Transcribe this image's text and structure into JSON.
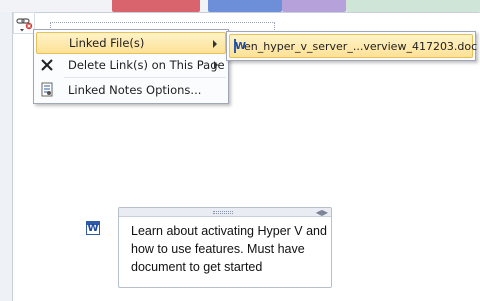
{
  "context_menu": {
    "items": [
      {
        "label": "Linked File(s)",
        "icon": "linked-file-icon",
        "has_submenu": true,
        "highlighted": true
      },
      {
        "label": "Delete Link(s) on This Page",
        "icon": "delete-x-icon",
        "has_submenu": true,
        "highlighted": false
      },
      {
        "label": "Linked Notes Options...",
        "icon": "options-document-icon",
        "has_submenu": false,
        "highlighted": false
      }
    ]
  },
  "submenu": {
    "file_name": "en_hyper_v_server_...verview_417203.doc",
    "file_icon_letter": "W"
  },
  "doc_icon_letter": "W",
  "note": {
    "text": "Learn about  activating Hyper V and how to use features. Must have document to get started"
  },
  "colors": {
    "highlight": "#fde196",
    "highlight_border": "#e6c05a",
    "word_blue": "#2f5aa8"
  }
}
